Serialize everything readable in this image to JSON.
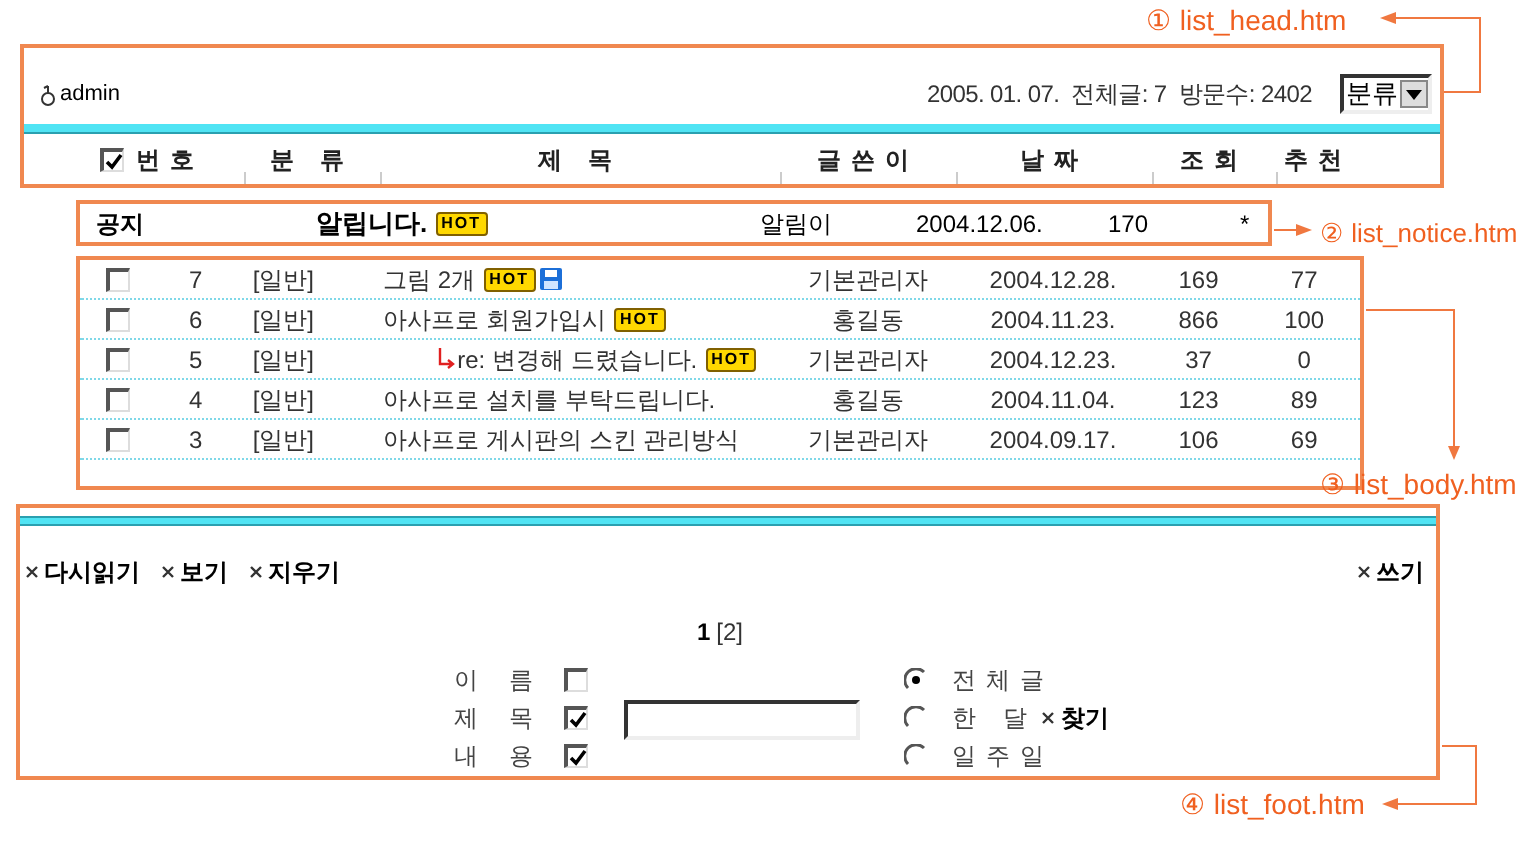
{
  "head": {
    "user": "admin",
    "stats": "2005. 01. 07.  전체글: 7  방문수: 2402",
    "category_select": "분류",
    "select_all_checked": true,
    "columns": [
      {
        "label": "번호"
      },
      {
        "label": "분 류"
      },
      {
        "label": "제 목"
      },
      {
        "label": "글쓴이"
      },
      {
        "label": "날짜"
      },
      {
        "label": "조회"
      },
      {
        "label": "추천"
      }
    ]
  },
  "notice": {
    "label": "공지",
    "title": "알립니다.",
    "badge": "HOT",
    "author": "알림이",
    "date": "2004.12.06.",
    "views": "170",
    "recommend": "*"
  },
  "rows": [
    {
      "checked": false,
      "number": "7",
      "category": "[일반]",
      "title": "그림 2개",
      "reply": false,
      "badge": "HOT",
      "attachment": true,
      "author": "기본관리자",
      "date": "2004.12.28.",
      "views": "169",
      "recommend": "77"
    },
    {
      "checked": false,
      "number": "6",
      "category": "[일반]",
      "title": "아사프로 회원가입시",
      "reply": false,
      "badge": "HOT",
      "attachment": false,
      "author": "홍길동",
      "date": "2004.11.23.",
      "views": "866",
      "recommend": "100"
    },
    {
      "checked": false,
      "number": "5",
      "category": "[일반]",
      "title": "re: 변경해 드렸습니다.",
      "reply": true,
      "badge": "HOT",
      "attachment": false,
      "author": "기본관리자",
      "date": "2004.12.23.",
      "views": "37",
      "recommend": "0"
    },
    {
      "checked": false,
      "number": "4",
      "category": "[일반]",
      "title": "아사프로 설치를 부탁드립니다.",
      "reply": false,
      "attachment": false,
      "author": "홍길동",
      "date": "2004.11.04.",
      "views": "123",
      "recommend": "89"
    },
    {
      "checked": false,
      "number": "3",
      "category": "[일반]",
      "title": "아사프로 게시판의 스킨 관리방식",
      "reply": false,
      "attachment": false,
      "author": "기본관리자",
      "date": "2004.09.17.",
      "views": "106",
      "recommend": "69"
    }
  ],
  "foot": {
    "left_buttons": [
      "다시읽기",
      "보기",
      "지우기"
    ],
    "write_button": "쓰기",
    "pages": [
      {
        "label": "1",
        "selected": true
      },
      {
        "label": "[2]",
        "selected": false
      }
    ],
    "search_fields": [
      {
        "label": "이 름",
        "checked": false
      },
      {
        "label": "제 목",
        "checked": true
      },
      {
        "label": "내 용",
        "checked": true
      }
    ],
    "periods": [
      {
        "label": "전체글",
        "selected": true
      },
      {
        "label": "한 달",
        "selected": false
      },
      {
        "label": "일주일",
        "selected": false
      }
    ],
    "search_button": "찾기"
  },
  "callouts": [
    "① list_head.htm",
    "② list_notice.htm",
    "③ list_body.htm",
    "④ list_foot.htm"
  ]
}
